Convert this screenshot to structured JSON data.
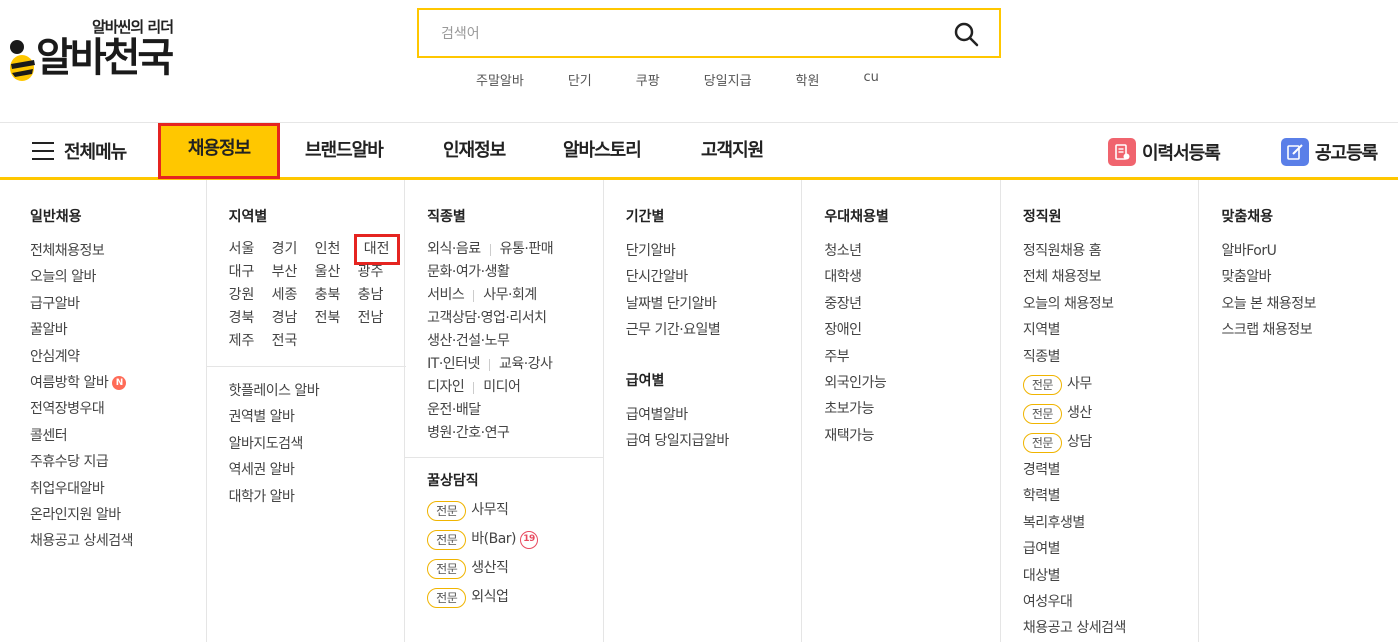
{
  "logo": {
    "slogan": "알바씬의 리더",
    "name": "알바천국"
  },
  "search": {
    "placeholder": "검색어",
    "keywords": [
      "주말알바",
      "단기",
      "쿠팡",
      "당일지급",
      "학원",
      "cu"
    ]
  },
  "gnb": {
    "menu_all": "전체메뉴",
    "tabs": [
      "채용정보",
      "브랜드알바",
      "인재정보",
      "알바스토리",
      "고객지원"
    ],
    "resume": "이력서등록",
    "post": "공고등록"
  },
  "mega": {
    "general": {
      "title": "일반채용",
      "items": [
        "전체채용정보",
        "오늘의 알바",
        "급구알바",
        "꿀알바",
        "안심계약",
        "여름방학 알바",
        "전역장병우대",
        "콜센터",
        "주휴수당 지급",
        "취업우대알바",
        "온라인지원 알바",
        "채용공고 상세검색"
      ],
      "new_badge": "N"
    },
    "region": {
      "title": "지역별",
      "regions": [
        "서울",
        "경기",
        "인천",
        "대전",
        "대구",
        "부산",
        "울산",
        "광주",
        "강원",
        "세종",
        "충북",
        "충남",
        "경북",
        "경남",
        "전북",
        "전남",
        "제주",
        "전국"
      ],
      "more": [
        "핫플레이스 알바",
        "권역별 알바",
        "알바지도검색",
        "역세권 알바",
        "대학가 알바"
      ]
    },
    "job": {
      "title": "직종별",
      "rows": [
        [
          "외식·음료",
          "유통·판매"
        ],
        [
          "문화·여가·생활"
        ],
        [
          "서비스",
          "사무·회계"
        ],
        [
          "고객상담·영업·리서치"
        ],
        [
          "생산·건설·노무"
        ],
        [
          "IT·인터넷",
          "교육·강사"
        ],
        [
          "디자인",
          "미디어"
        ],
        [
          "운전·배달"
        ],
        [
          "병원·간호·연구"
        ]
      ],
      "honey_title": "꿀상담직",
      "pro_label": "전문",
      "honey_items": [
        "사무직",
        "바(Bar)",
        "생산직",
        "외식업"
      ],
      "adult_badge": "19"
    },
    "period": {
      "title": "기간별",
      "items": [
        "단기알바",
        "단시간알바",
        "날짜별 단기알바",
        "근무 기간·요일별"
      ],
      "pay_title": "급여별",
      "pay_items": [
        "급여별알바",
        "급여 당일지급알바"
      ]
    },
    "prefer": {
      "title": "우대채용별",
      "items": [
        "청소년",
        "대학생",
        "중장년",
        "장애인",
        "주부",
        "외국인가능",
        "초보가능",
        "재택가능"
      ]
    },
    "regular": {
      "title": "정직원",
      "items_top": [
        "정직원채용 홈",
        "전체 채용정보",
        "오늘의 채용정보",
        "지역별",
        "직종별"
      ],
      "pro_label": "전문",
      "pro_items": [
        "사무",
        "생산",
        "상담"
      ],
      "items_bottom": [
        "경력별",
        "학력별",
        "복리후생별",
        "급여별",
        "대상별",
        "여성우대",
        "채용공고 상세검색"
      ]
    },
    "custom": {
      "title": "맞춤채용",
      "items": [
        "알바ForU",
        "맞춤알바",
        "오늘 본 채용정보",
        "스크랩 채용정보"
      ]
    }
  },
  "colors": {
    "accent": "#ffc700",
    "highlight": "#e52420",
    "resume_icon": "#f0646e",
    "post_icon": "#5a7fe8"
  }
}
